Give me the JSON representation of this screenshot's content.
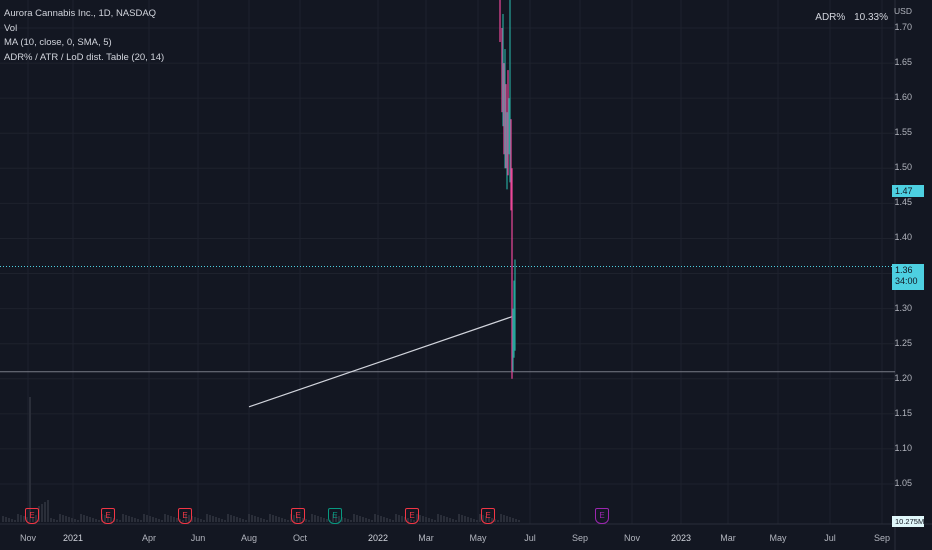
{
  "legend": {
    "symbol": "Aurora Cannabis Inc., 1D, NASDAQ",
    "vol": "Vol",
    "ma": "MA (10, close, 0, SMA, 5)",
    "table": "ADR% / ATR / LoD dist. Table (20, 14)"
  },
  "adr": {
    "label": "ADR%",
    "value": "10.33%"
  },
  "price_axis": {
    "currency": "USD",
    "labels": [
      "1.70",
      "1.65",
      "1.60",
      "1.55",
      "1.50",
      "1.45",
      "1.40",
      "1.35",
      "1.30",
      "1.25",
      "1.20",
      "1.15",
      "1.10",
      "1.05"
    ]
  },
  "time_axis": {
    "labels": [
      "Nov",
      "2021",
      "Apr",
      "Jun",
      "Aug",
      "Oct",
      "2022",
      "Mar",
      "May",
      "Jul",
      "Sep",
      "Nov",
      "2023",
      "Mar",
      "May",
      "Jul",
      "Sep"
    ]
  },
  "price_tags": {
    "last": "1.47",
    "current": "1.36",
    "countdown": "34:00",
    "volume": "10.275M"
  },
  "events": {
    "earnings_letter": "E",
    "colors": {
      "red": "#f23645",
      "teal": "#089981",
      "purple": "#9c27b0"
    }
  },
  "chart_data": {
    "type": "line",
    "y_axis": {
      "min": 1.0,
      "max": 1.75,
      "unit": "USD"
    },
    "horizontal_lines": [
      {
        "price": 1.36,
        "color": "#4dd0e1",
        "style": "dotted"
      },
      {
        "price": 1.21,
        "color": "#787b86",
        "style": "solid"
      }
    ],
    "trend_line": {
      "from": {
        "x": "Aug 2021",
        "y": 1.16
      },
      "to": {
        "x": "Jun 2022",
        "y": 1.29
      }
    }
  }
}
